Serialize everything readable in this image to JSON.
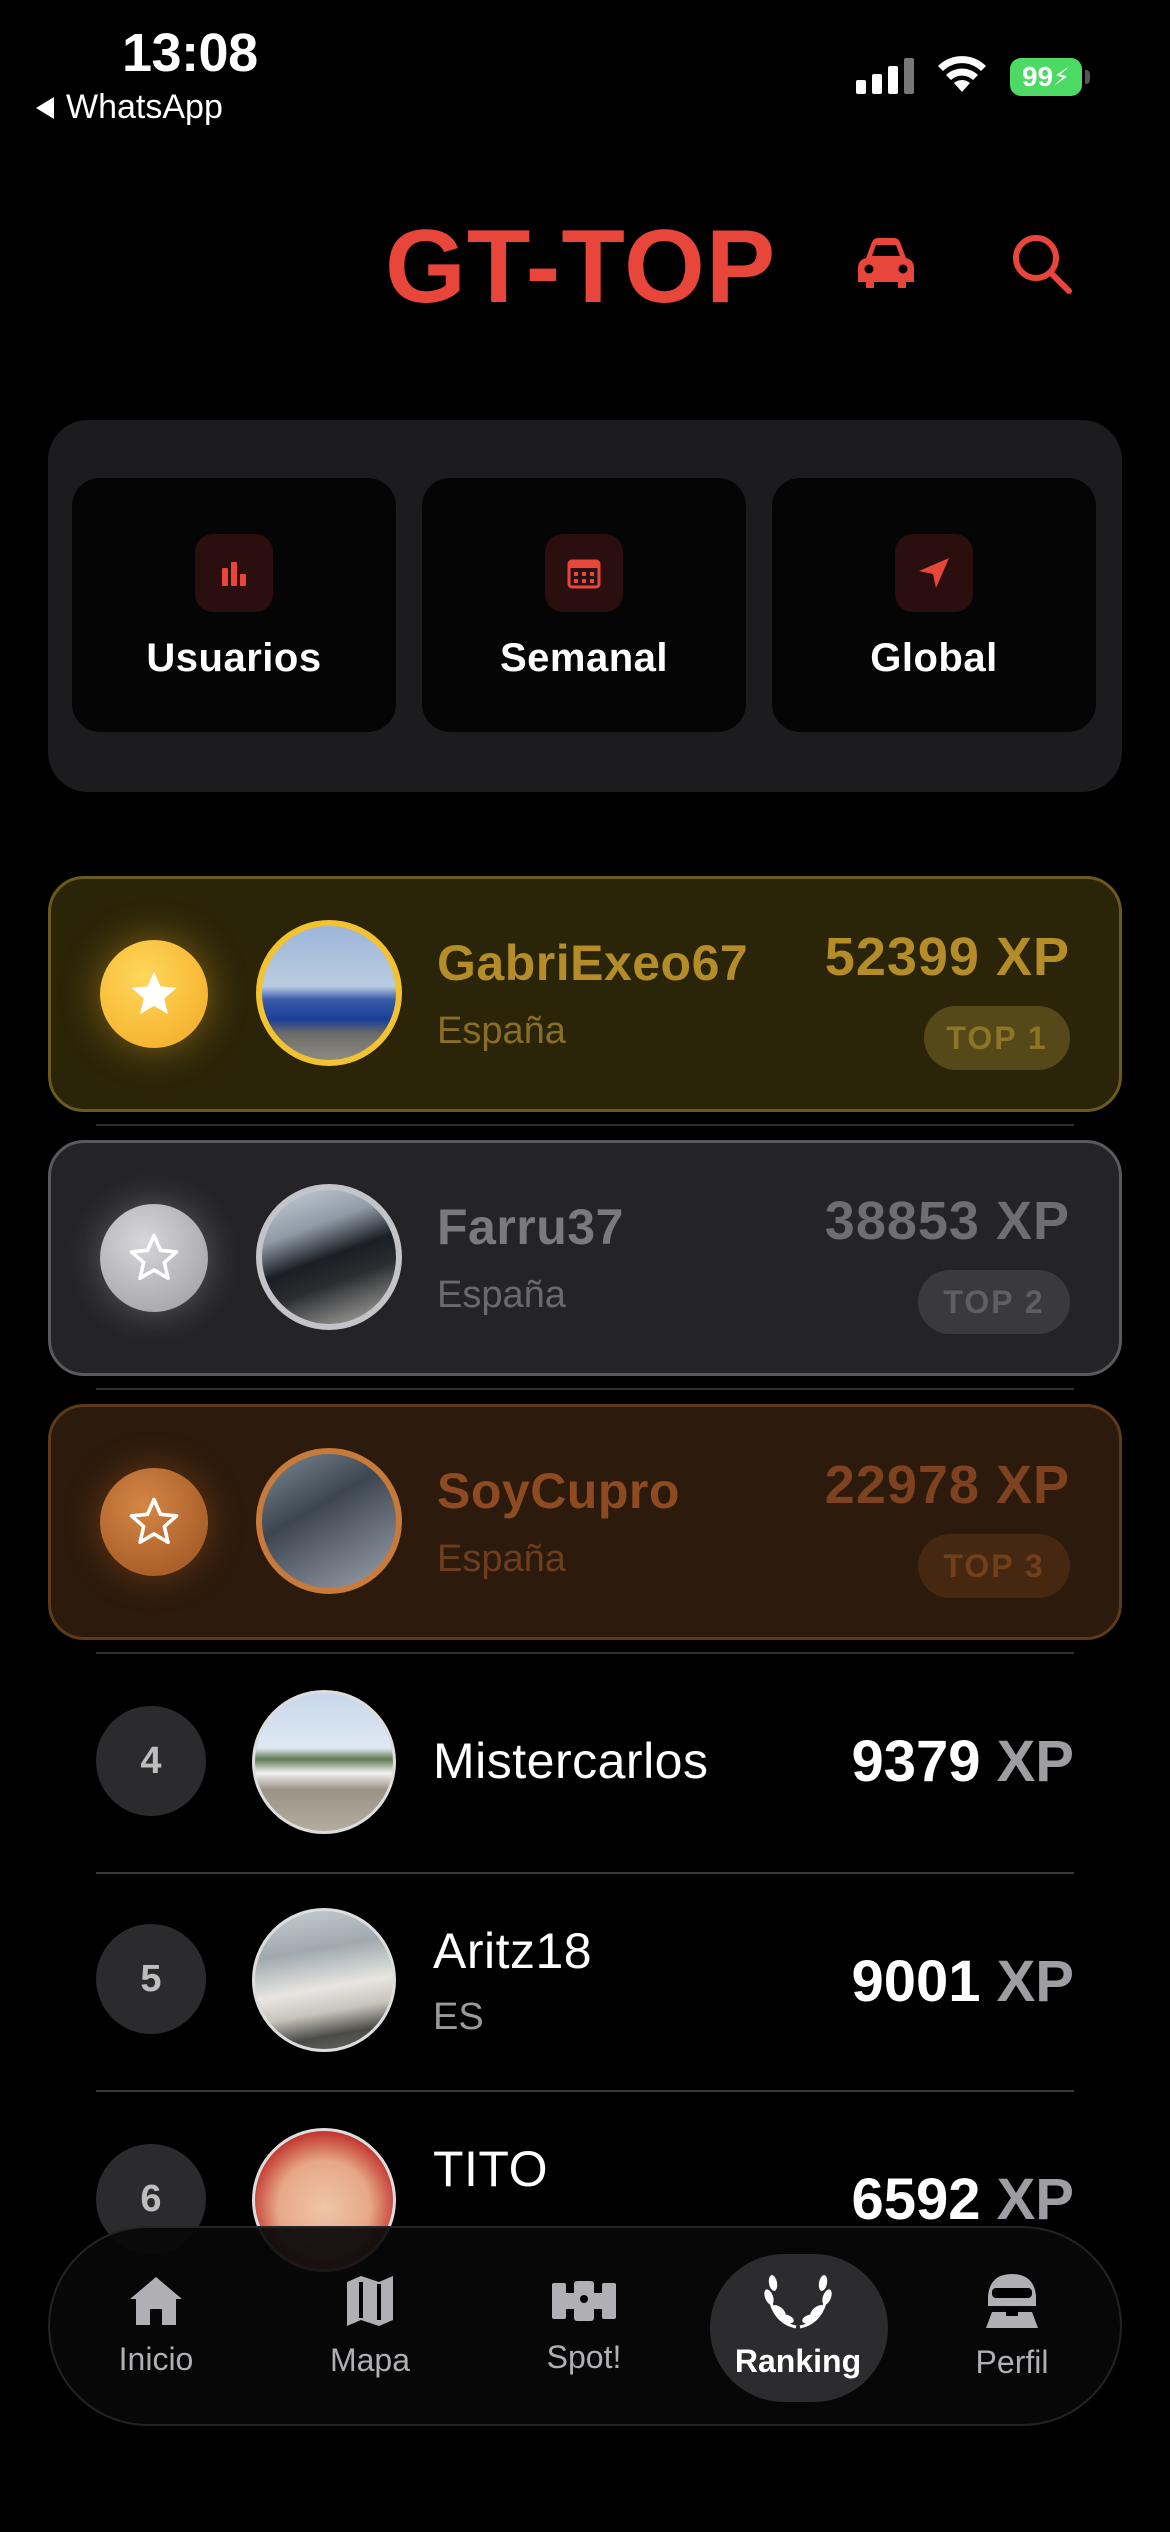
{
  "status_bar": {
    "time": "13:08",
    "back_app": "WhatsApp",
    "battery": "99"
  },
  "header": {
    "title": "GT-TOP",
    "icons": [
      "car-icon",
      "search-icon"
    ]
  },
  "filters": [
    {
      "label": "Usuarios",
      "icon": "bar-chart-icon"
    },
    {
      "label": "Semanal",
      "icon": "calendar-icon"
    },
    {
      "label": "Global",
      "icon": "location-arrow-icon"
    }
  ],
  "podium": [
    {
      "name": "GabriExeo67",
      "country": "España",
      "xp": "52399 XP",
      "badge": "TOP 1"
    },
    {
      "name": "Farru37",
      "country": "España",
      "xp": "38853 XP",
      "badge": "TOP 2"
    },
    {
      "name": "SoyCupro",
      "country": "España",
      "xp": "22978 XP",
      "badge": "TOP 3"
    }
  ],
  "list": [
    {
      "rank": "4",
      "name": "Mistercarlos",
      "sub": "",
      "xp": "9379",
      "unit": "XP"
    },
    {
      "rank": "5",
      "name": "Aritz18",
      "sub": "ES",
      "xp": "9001",
      "unit": "XP"
    },
    {
      "rank": "6",
      "name": "TITO",
      "sub": "",
      "xp": "6592",
      "unit": "XP"
    }
  ],
  "tabs": [
    {
      "label": "Inicio",
      "icon": "home-icon"
    },
    {
      "label": "Mapa",
      "icon": "map-icon"
    },
    {
      "label": "Spot!",
      "icon": "race-car-icon"
    },
    {
      "label": "Ranking",
      "icon": "laurel-icon",
      "active": true
    },
    {
      "label": "Perfil",
      "icon": "helmet-icon"
    }
  ],
  "colors": {
    "accent": "#e8453b",
    "gold": "#f2b630",
    "silver": "#b8b8bb",
    "bronze": "#b9662b"
  }
}
